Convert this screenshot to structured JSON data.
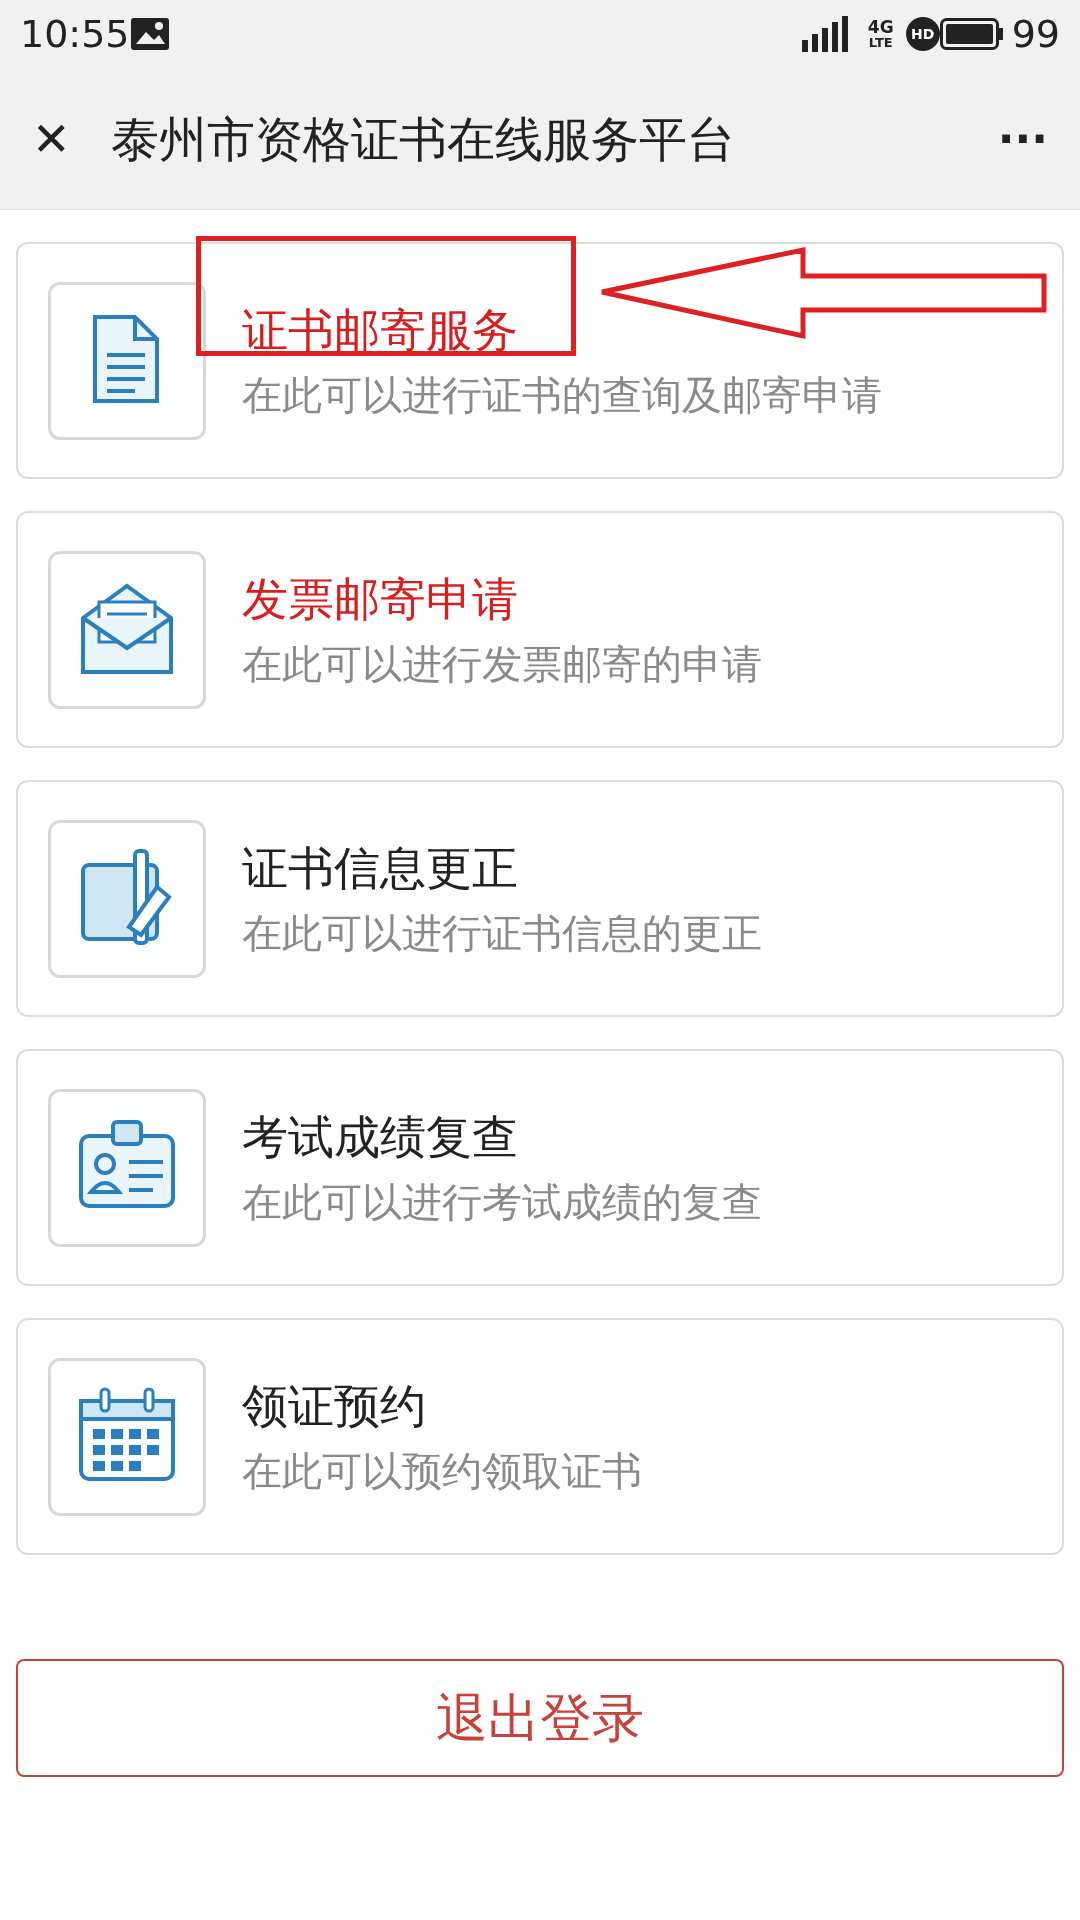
{
  "status_bar": {
    "time": "10:55",
    "network": "4G",
    "network_sub": "LTE",
    "hd": "HD",
    "battery": "99"
  },
  "header": {
    "close": "✕",
    "title": "泰州市资格证书在线服务平台",
    "more": "···"
  },
  "services": [
    {
      "kind": "document",
      "title": "证书邮寄服务",
      "subtitle": "在此可以进行证书的查询及邮寄申请",
      "highlighted": true,
      "annotated": true
    },
    {
      "kind": "envelope",
      "title": "发票邮寄申请",
      "subtitle": "在此可以进行发票邮寄的申请",
      "highlighted": true,
      "annotated": false
    },
    {
      "kind": "card",
      "title": "证书信息更正",
      "subtitle": "在此可以进行证书信息的更正",
      "highlighted": false,
      "annotated": false
    },
    {
      "kind": "badge",
      "title": "考试成绩复查",
      "subtitle": "在此可以进行考试成绩的复查",
      "highlighted": false,
      "annotated": false
    },
    {
      "kind": "calendar",
      "title": "领证预约",
      "subtitle": "在此可以预约领取证书",
      "highlighted": false,
      "annotated": false
    }
  ],
  "logout": "退出登录"
}
